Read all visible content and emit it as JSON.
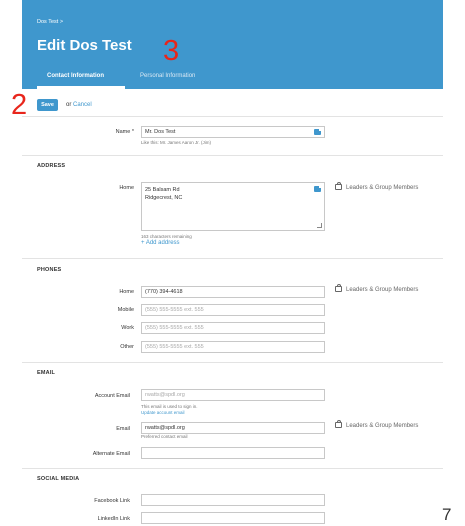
{
  "header": {
    "breadcrumb": "Dos Test >",
    "title": "Edit Dos Test",
    "tabs": [
      {
        "label": "Contact Information"
      },
      {
        "label": "Personal Information"
      }
    ]
  },
  "annotations": {
    "step3": "3",
    "step2": "2",
    "page_number": "7"
  },
  "actions": {
    "save_label": "Save",
    "or_text": "or",
    "cancel_label": "Cancel"
  },
  "name_section": {
    "label": "Name *",
    "value": "Mr. Dos Test",
    "helper": "Like this: Mr. James Aaron Jr. (Jim)"
  },
  "address": {
    "heading": "ADDRESS",
    "home_label": "Home",
    "line1": "25 Balsam Rd",
    "line2": "Ridgecrest, NC",
    "chars_remaining": "163 characters remaining",
    "add_address": "+ Add address",
    "visibility": "Leaders & Group Members"
  },
  "phones": {
    "heading": "PHONES",
    "rows": [
      {
        "label": "Home",
        "value": "(770) 394-4618",
        "placeholder": ""
      },
      {
        "label": "Mobile",
        "value": "",
        "placeholder": "(555) 555-5555 ext. 555"
      },
      {
        "label": "Work",
        "value": "",
        "placeholder": "(555) 555-5555 ext. 555"
      },
      {
        "label": "Other",
        "value": "",
        "placeholder": "(555) 555-5555 ext. 555"
      }
    ],
    "visibility": "Leaders & Group Members"
  },
  "email": {
    "heading": "EMAIL",
    "account_label": "Account Email",
    "account_value": "rwatts@spdl.org",
    "account_helper": "This email is used to sign in.",
    "update_link": "Update account email",
    "email_label": "Email",
    "email_value": "rwatts@spdl.org",
    "email_helper": "Preferred contact email",
    "alternate_label": "Alternate Email",
    "alternate_value": "",
    "visibility": "Leaders & Group Members"
  },
  "social": {
    "heading": "SOCIAL MEDIA",
    "facebook_label": "Facebook Link",
    "linkedin_label": "LinkedIn Link"
  }
}
